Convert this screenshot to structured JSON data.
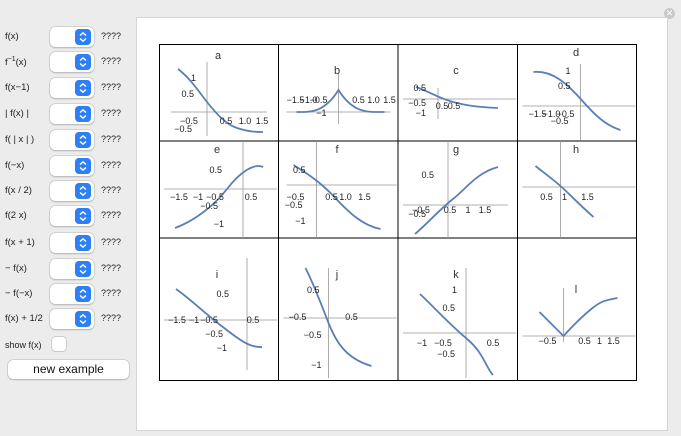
{
  "controls": [
    {
      "label": "f(x)",
      "value": "????"
    },
    {
      "label": "f",
      "label_sup": "−1",
      "label_tail": "(x)",
      "value": "????"
    },
    {
      "label": "f(x−1)",
      "value": "????"
    },
    {
      "label": "| f(x) |",
      "value": "????"
    },
    {
      "label": "f( | x | )",
      "value": "????"
    },
    {
      "label": "f(−x)",
      "value": "????"
    },
    {
      "label": "f(x / 2)",
      "value": "????"
    },
    {
      "label": "f(2 x)",
      "value": "????"
    },
    {
      "label": "f(x + 1)",
      "value": "????"
    },
    {
      "label": "− f(x)",
      "value": "????"
    },
    {
      "label": "− f(−x)",
      "value": "????"
    },
    {
      "label": "f(x) + 1/2",
      "value": "????"
    }
  ],
  "show_fx": {
    "label": "show f(x)",
    "checked": false
  },
  "new_example_label": "new example",
  "plots": [
    {
      "letter": "a",
      "xticks": [
        "−0.5",
        "0.5",
        "1.0",
        "1.5"
      ],
      "yticks": [
        "1",
        "0.5",
        "−0.5"
      ]
    },
    {
      "letter": "b",
      "xticks": [
        "−1.5",
        "−1.0",
        "−0.5",
        "0.5",
        "1.0",
        "1.5"
      ],
      "yticks": [
        "−1"
      ]
    },
    {
      "letter": "c",
      "xticks": [
        "0.5",
        "0.5",
        "1"
      ],
      "yticks": [
        "0.5",
        "−0.5",
        "−1"
      ]
    },
    {
      "letter": "d",
      "xticks": [
        "−1.5",
        "−1.0",
        "−0.5"
      ],
      "yticks": [
        "1",
        "0.5",
        "−0.5"
      ]
    },
    {
      "letter": "e",
      "xticks": [
        "−1.5",
        "−1",
        "−0.5",
        "0.5"
      ],
      "yticks": [
        "0.5",
        "−0.5",
        "−1"
      ]
    },
    {
      "letter": "f",
      "xticks": [
        "−0.5",
        "0.5",
        "1.0",
        "1.5"
      ],
      "yticks": [
        "0.5",
        "−0.5",
        "−1"
      ]
    },
    {
      "letter": "g",
      "xticks": [
        "−0.5",
        "0.5",
        "1",
        "1.5"
      ],
      "yticks": [
        "0.5",
        "−0.5"
      ]
    },
    {
      "letter": "h",
      "xticks": [
        "0.5",
        "1",
        "1.5"
      ],
      "yticks": []
    },
    {
      "letter": "i",
      "xticks": [
        "−1.5",
        "−1",
        "−0.5",
        "0.5"
      ],
      "yticks": [
        "0.5",
        "−0.5",
        "−1"
      ]
    },
    {
      "letter": "j",
      "xticks": [
        "−0.5",
        "0.5"
      ],
      "yticks": [
        "0.5",
        "−0.5",
        "−1"
      ]
    },
    {
      "letter": "k",
      "xticks": [
        "−1",
        "−0.5",
        "0.5"
      ],
      "yticks": [
        "1",
        "0.5",
        "−0.5"
      ]
    },
    {
      "letter": "l",
      "xticks": [
        "−0.5",
        "0.5",
        "1",
        "1.5"
      ],
      "yticks": []
    }
  ],
  "colors": {
    "curve": "#5a7fb5",
    "arrow": "#2d7ff7",
    "grid": "#000000"
  }
}
